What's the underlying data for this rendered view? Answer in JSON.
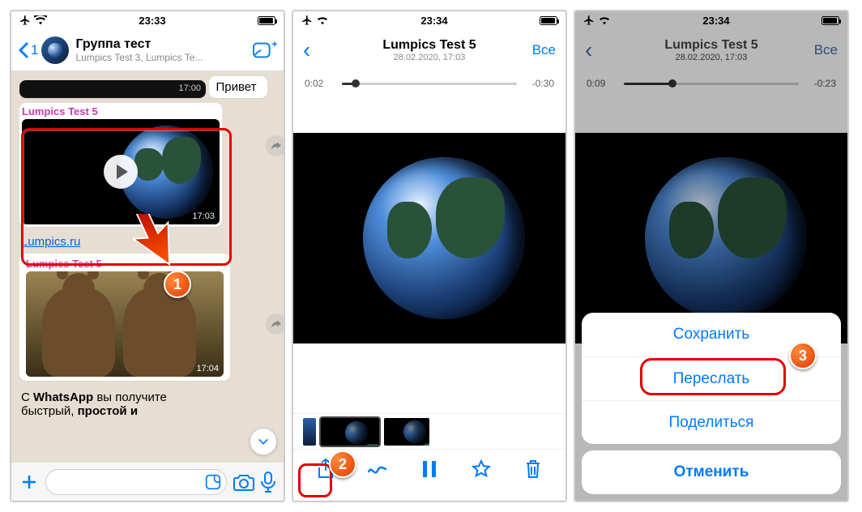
{
  "status": {
    "time": "23:33",
    "time2": "23:34",
    "time3": "23:34"
  },
  "screen1": {
    "back_count": "1",
    "chat_title": "Группа тест",
    "chat_subtitle": "Lumpics Test 3, Lumpics Te...",
    "top_stub_time": "17:00",
    "msg_hi": "Привет",
    "msg_hi_time": "",
    "sender": "Lumpics Test 5",
    "video_time": "17:03",
    "link": "Lumpics.ru",
    "sender2": "Lumpics Test 5",
    "bears_time": "17:04",
    "footer_text_1": "С ",
    "footer_text_bold1": "WhatsApp",
    "footer_text_2": " вы получите\nбыстрый, ",
    "footer_text_bold2": "простой и"
  },
  "screen2": {
    "title": "Lumpics Test 5",
    "subtitle": "28.02.2020, 17:03",
    "all_label": "Все",
    "time_elapsed": "0:02",
    "time_remaining": "-0:30",
    "progress_pct": 8
  },
  "screen3": {
    "title": "Lumpics Test 5",
    "subtitle": "28.02.2020, 17:03",
    "all_label": "Все",
    "time_elapsed": "0:09",
    "time_remaining": "-0:23",
    "progress_pct": 28,
    "action_save": "Сохранить",
    "action_forward": "Переслать",
    "action_share": "Поделиться",
    "action_cancel": "Отменить"
  },
  "markers": {
    "m1": "1",
    "m2": "2",
    "m3": "3"
  }
}
